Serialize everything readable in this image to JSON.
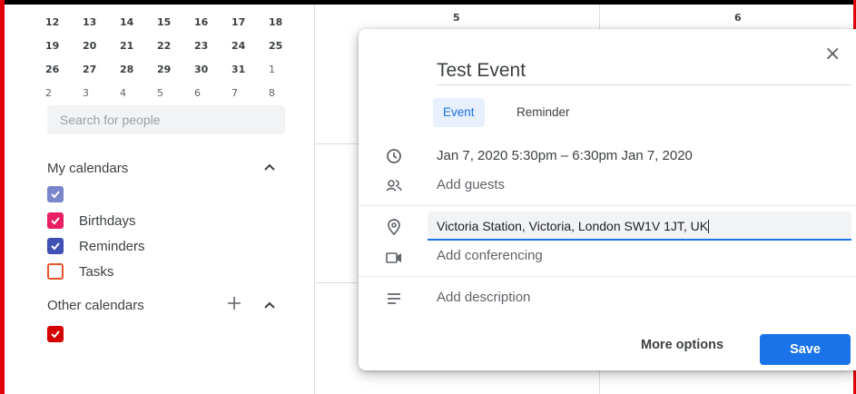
{
  "mini_calendar": {
    "rows": [
      [
        {
          "d": "12"
        },
        {
          "d": "13"
        },
        {
          "d": "14"
        },
        {
          "d": "15"
        },
        {
          "d": "16"
        },
        {
          "d": "17"
        },
        {
          "d": "18"
        }
      ],
      [
        {
          "d": "19"
        },
        {
          "d": "20"
        },
        {
          "d": "21"
        },
        {
          "d": "22"
        },
        {
          "d": "23"
        },
        {
          "d": "24"
        },
        {
          "d": "25"
        }
      ],
      [
        {
          "d": "26"
        },
        {
          "d": "27"
        },
        {
          "d": "28"
        },
        {
          "d": "29"
        },
        {
          "d": "30"
        },
        {
          "d": "31"
        },
        {
          "d": "1"
        }
      ],
      [
        {
          "d": "2"
        },
        {
          "d": "3"
        },
        {
          "d": "4"
        },
        {
          "d": "5"
        },
        {
          "d": "6"
        },
        {
          "d": "7"
        },
        {
          "d": "8"
        }
      ]
    ]
  },
  "sidebar": {
    "search_placeholder": "Search for people",
    "my_calendars_title": "My calendars",
    "my_calendars": [
      {
        "label": "",
        "color": "#7986cb",
        "checked": true
      },
      {
        "label": "Birthdays",
        "color": "#e91e63",
        "checked": true
      },
      {
        "label": "Reminders",
        "color": "#3f51b5",
        "checked": true
      },
      {
        "label": "Tasks",
        "color": "#e8532b",
        "checked": false
      }
    ],
    "other_calendars_title": "Other calendars",
    "other_calendars": [
      {
        "label": "",
        "color": "#d50000",
        "checked": true
      }
    ]
  },
  "grid": {
    "day_numbers": [
      "5",
      "6"
    ]
  },
  "dialog": {
    "title": "Test Event",
    "tabs": {
      "event": "Event",
      "reminder": "Reminder"
    },
    "datetime": "Jan 7, 2020   5:30pm  –  6:30pm   Jan 7, 2020",
    "add_guests": "Add guests",
    "location_value": "Victoria Station, Victoria, London SW1V 1JT, UK",
    "add_conferencing": "Add conferencing",
    "add_description": "Add description",
    "more_options": "More options",
    "save": "Save",
    "close_glyph": "×"
  },
  "colors": {
    "accent": "#1a73e8",
    "frame_left": "#e0000a"
  }
}
